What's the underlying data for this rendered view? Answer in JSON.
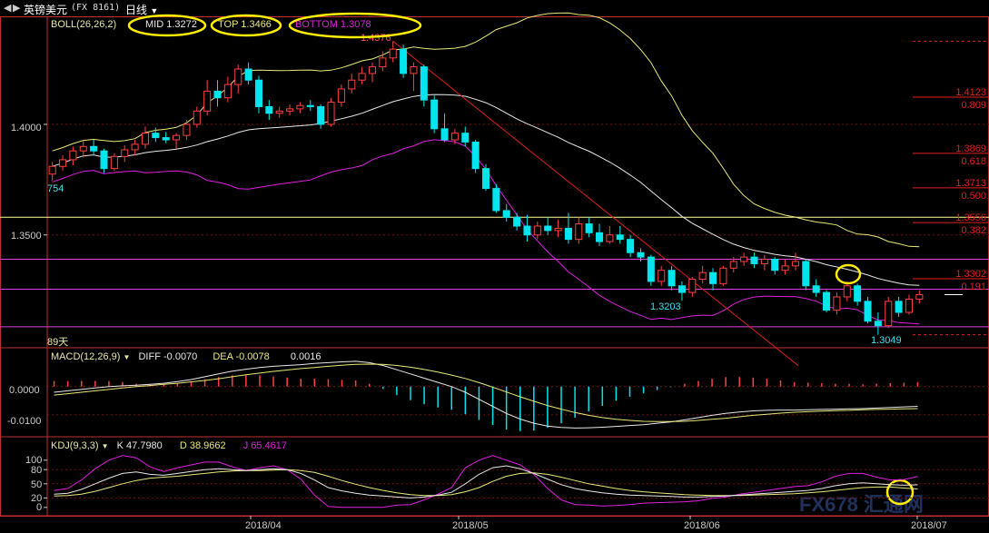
{
  "window": {
    "title": "英镑美元",
    "symbol_code": "(FX 8161)",
    "timeframe": "日线",
    "nav_icons": [
      "chevron-left-icon",
      "chevron-right-icon"
    ]
  },
  "colors": {
    "up": "#ff4040",
    "down": "#00e5ee",
    "mid": "#e8e8e8",
    "top": "#e8e878",
    "bottom": "#e020e0",
    "trend": "#e02020",
    "fib": "#e02020",
    "hline_yellow": "#ffff99",
    "hline_magenta": "#e040e0",
    "highlight": "#ffee00",
    "axis": "#cccccc",
    "panel_border": "#c03030"
  },
  "chart_data": [
    {
      "type": "candlestick",
      "title": "",
      "indicator_label": "BOLL(26,26,2)",
      "legend": [
        {
          "name": "MID",
          "value": "1.3272"
        },
        {
          "name": "TOP",
          "value": "1.3466"
        },
        {
          "name": "BOTTOM",
          "value": "1.3078"
        }
      ],
      "y_ticks": [
        "1.4000",
        "1.3500"
      ],
      "x_ticks": [
        "2018/04",
        "2018/05",
        "2018/06",
        "2018/07"
      ],
      "annotations": {
        "high": "1.4376",
        "low1": "1.3203",
        "low2": "1.3049",
        "left_edge": "754",
        "period": "89天"
      },
      "fib_levels": [
        {
          "price": "1.4123",
          "ratio": "0.809"
        },
        {
          "price": "1.3869",
          "ratio": "0.618"
        },
        {
          "price": "1.3713",
          "ratio": "0.500"
        },
        {
          "price": "1.3556",
          "ratio": "0.382"
        },
        {
          "price": "1.3302",
          "ratio": "0.191"
        }
      ],
      "horizontal_lines": [
        1.358,
        1.339,
        1.3255,
        1.3085
      ],
      "trend_line": {
        "from": {
          "i": 33,
          "p": 1.4376
        },
        "to": {
          "i": 67,
          "p": 1.295
        }
      },
      "ohlc": [
        [
          1.3775,
          1.383,
          1.3745,
          1.381
        ],
        [
          1.381,
          1.386,
          1.379,
          1.384
        ],
        [
          1.384,
          1.39,
          1.3815,
          1.388
        ],
        [
          1.388,
          1.3925,
          1.385,
          1.39
        ],
        [
          1.39,
          1.393,
          1.386,
          1.388
        ],
        [
          1.388,
          1.389,
          1.378,
          1.38
        ],
        [
          1.38,
          1.387,
          1.379,
          1.3855
        ],
        [
          1.3855,
          1.3905,
          1.383,
          1.3885
        ],
        [
          1.3885,
          1.393,
          1.386,
          1.391
        ],
        [
          1.391,
          1.399,
          1.389,
          1.396
        ],
        [
          1.396,
          1.3985,
          1.392,
          1.394
        ],
        [
          1.394,
          1.3965,
          1.3915,
          1.393
        ],
        [
          1.393,
          1.396,
          1.389,
          1.395
        ],
        [
          1.395,
          1.402,
          1.393,
          1.4
        ],
        [
          1.4,
          1.408,
          1.3985,
          1.406
        ],
        [
          1.406,
          1.42,
          1.404,
          1.415
        ],
        [
          1.415,
          1.42,
          1.408,
          1.412
        ],
        [
          1.412,
          1.4215,
          1.41,
          1.418
        ],
        [
          1.418,
          1.427,
          1.414,
          1.425
        ],
        [
          1.425,
          1.428,
          1.418,
          1.42
        ],
        [
          1.42,
          1.422,
          1.405,
          1.408
        ],
        [
          1.408,
          1.411,
          1.402,
          1.405
        ],
        [
          1.405,
          1.408,
          1.403,
          1.406
        ],
        [
          1.406,
          1.409,
          1.404,
          1.407
        ],
        [
          1.407,
          1.41,
          1.405,
          1.4085
        ],
        [
          1.4085,
          1.411,
          1.406,
          1.408
        ],
        [
          1.408,
          1.409,
          1.398,
          1.4
        ],
        [
          1.4,
          1.412,
          1.399,
          1.41
        ],
        [
          1.41,
          1.418,
          1.408,
          1.416
        ],
        [
          1.416,
          1.423,
          1.414,
          1.42
        ],
        [
          1.42,
          1.426,
          1.418,
          1.423
        ],
        [
          1.423,
          1.428,
          1.419,
          1.426
        ],
        [
          1.426,
          1.433,
          1.424,
          1.43
        ],
        [
          1.43,
          1.4376,
          1.428,
          1.434
        ],
        [
          1.434,
          1.436,
          1.421,
          1.423
        ],
        [
          1.423,
          1.428,
          1.415,
          1.426
        ],
        [
          1.426,
          1.427,
          1.408,
          1.411
        ],
        [
          1.411,
          1.413,
          1.396,
          1.398
        ],
        [
          1.398,
          1.405,
          1.392,
          1.393
        ],
        [
          1.393,
          1.398,
          1.391,
          1.396
        ],
        [
          1.396,
          1.399,
          1.39,
          1.392
        ],
        [
          1.392,
          1.393,
          1.378,
          1.38
        ],
        [
          1.38,
          1.382,
          1.37,
          1.371
        ],
        [
          1.371,
          1.373,
          1.36,
          1.361
        ],
        [
          1.361,
          1.364,
          1.356,
          1.358
        ],
        [
          1.358,
          1.36,
          1.352,
          1.354
        ],
        [
          1.354,
          1.359,
          1.347,
          1.35
        ],
        [
          1.35,
          1.356,
          1.348,
          1.354
        ],
        [
          1.354,
          1.358,
          1.35,
          1.352
        ],
        [
          1.352,
          1.357,
          1.349,
          1.353
        ],
        [
          1.353,
          1.36,
          1.346,
          1.348
        ],
        [
          1.348,
          1.358,
          1.346,
          1.355
        ],
        [
          1.355,
          1.358,
          1.349,
          1.351
        ],
        [
          1.351,
          1.355,
          1.345,
          1.347
        ],
        [
          1.347,
          1.354,
          1.346,
          1.35
        ],
        [
          1.35,
          1.354,
          1.346,
          1.348
        ],
        [
          1.348,
          1.35,
          1.34,
          1.342
        ],
        [
          1.342,
          1.344,
          1.338,
          1.34
        ],
        [
          1.34,
          1.341,
          1.327,
          1.329
        ],
        [
          1.329,
          1.336,
          1.327,
          1.334
        ],
        [
          1.334,
          1.336,
          1.325,
          1.327
        ],
        [
          1.327,
          1.329,
          1.3203,
          1.324
        ],
        [
          1.324,
          1.331,
          1.322,
          1.33
        ],
        [
          1.33,
          1.336,
          1.328,
          1.333
        ],
        [
          1.333,
          1.335,
          1.325,
          1.328
        ],
        [
          1.328,
          1.336,
          1.327,
          1.335
        ],
        [
          1.335,
          1.34,
          1.333,
          1.338
        ],
        [
          1.338,
          1.342,
          1.336,
          1.34
        ],
        [
          1.34,
          1.342,
          1.335,
          1.337
        ],
        [
          1.337,
          1.341,
          1.334,
          1.339
        ],
        [
          1.339,
          1.34,
          1.332,
          1.334
        ],
        [
          1.334,
          1.339,
          1.332,
          1.336
        ],
        [
          1.336,
          1.342,
          1.334,
          1.338
        ],
        [
          1.338,
          1.339,
          1.325,
          1.327
        ],
        [
          1.327,
          1.33,
          1.322,
          1.324
        ],
        [
          1.324,
          1.325,
          1.315,
          1.316
        ],
        [
          1.316,
          1.324,
          1.314,
          1.322
        ],
        [
          1.322,
          1.329,
          1.32,
          1.327
        ],
        [
          1.327,
          1.328,
          1.318,
          1.32
        ],
        [
          1.32,
          1.322,
          1.31,
          1.311
        ],
        [
          1.311,
          1.315,
          1.3049,
          1.309
        ],
        [
          1.309,
          1.322,
          1.308,
          1.32
        ],
        [
          1.32,
          1.322,
          1.313,
          1.315
        ],
        [
          1.315,
          1.323,
          1.314,
          1.321
        ],
        [
          1.321,
          1.325,
          1.319,
          1.323
        ]
      ]
    },
    {
      "type": "macd",
      "indicator_label": "MACD(12,26,9)",
      "legend": [
        {
          "name": "DIFF",
          "value": "-0.0070"
        },
        {
          "name": "DEA",
          "value": "-0.0078"
        },
        {
          "name": "",
          "value": "0.0016"
        }
      ],
      "y_ticks": [
        "0.0000",
        "-0.0100"
      ],
      "diff": [
        -0.002,
        -0.0015,
        -0.001,
        -0.0005,
        0,
        0.0003,
        0.0005,
        0.0008,
        0.0012,
        0.0018,
        0.0025,
        0.0035,
        0.0045,
        0.0055,
        0.0062,
        0.0068,
        0.0072,
        0.0075,
        0.0078,
        0.0082,
        0.0085,
        0.0088,
        0.009,
        0.0085,
        0.0075,
        0.006,
        0.0045,
        0.003,
        0.0015,
        0,
        -0.002,
        -0.0045,
        -0.007,
        -0.0095,
        -0.0115,
        -0.013,
        -0.014,
        -0.0145,
        -0.0147,
        -0.0146,
        -0.0144,
        -0.0141,
        -0.0138,
        -0.0135,
        -0.013,
        -0.0125,
        -0.0118,
        -0.011,
        -0.0102,
        -0.0095,
        -0.009,
        -0.0086,
        -0.0084,
        -0.0083,
        -0.0083,
        -0.0082,
        -0.0081,
        -0.008,
        -0.0079,
        -0.0078,
        -0.0076,
        -0.0074,
        -0.0072,
        -0.007
      ],
      "dea": [
        -0.003,
        -0.0025,
        -0.002,
        -0.0015,
        -0.001,
        -0.0005,
        0,
        0.0004,
        0.0008,
        0.0012,
        0.0017,
        0.0022,
        0.0028,
        0.0035,
        0.0042,
        0.0048,
        0.0054,
        0.0059,
        0.0064,
        0.0068,
        0.0072,
        0.0076,
        0.0079,
        0.008,
        0.0079,
        0.0075,
        0.0069,
        0.0061,
        0.0052,
        0.0041,
        0.0029,
        0.0014,
        -0.0002,
        -0.0019,
        -0.0036,
        -0.0052,
        -0.0067,
        -0.008,
        -0.0092,
        -0.0102,
        -0.011,
        -0.0116,
        -0.012,
        -0.0123,
        -0.0124,
        -0.0124,
        -0.0123,
        -0.012,
        -0.0116,
        -0.0112,
        -0.0107,
        -0.0102,
        -0.0098,
        -0.0094,
        -0.0091,
        -0.0089,
        -0.0087,
        -0.0085,
        -0.0084,
        -0.0082,
        -0.0081,
        -0.008,
        -0.0079,
        -0.0078
      ]
    },
    {
      "type": "kdj",
      "indicator_label": "KDJ(9,3,3)",
      "legend": [
        {
          "name": "K",
          "value": "47.7980"
        },
        {
          "name": "D",
          "value": "38.9662"
        },
        {
          "name": "J",
          "value": "65.4617"
        }
      ],
      "y_ticks": [
        "100",
        "80",
        "50",
        "20",
        "0"
      ],
      "k": [
        28,
        30,
        38,
        50,
        62,
        72,
        75,
        70,
        68,
        72,
        76,
        80,
        82,
        80,
        78,
        80,
        82,
        80,
        72,
        58,
        42,
        35,
        30,
        26,
        24,
        22,
        20,
        22,
        26,
        32,
        50,
        70,
        84,
        88,
        82,
        72,
        60,
        48,
        40,
        35,
        31,
        28,
        26,
        25,
        24,
        23,
        22,
        22,
        23,
        24,
        26,
        28,
        30,
        32,
        34,
        36,
        40,
        46,
        50,
        52,
        50,
        48,
        47,
        47.8
      ],
      "d": [
        24,
        25,
        28,
        34,
        42,
        50,
        57,
        62,
        64,
        66,
        69,
        72,
        75,
        77,
        78,
        78,
        79,
        80,
        78,
        74,
        66,
        57,
        49,
        42,
        36,
        31,
        27,
        25,
        25,
        27,
        33,
        42,
        55,
        66,
        72,
        73,
        70,
        64,
        57,
        50,
        45,
        40,
        36,
        33,
        31,
        29,
        27,
        26,
        25,
        25,
        25,
        26,
        27,
        28,
        29,
        31,
        33,
        36,
        39,
        42,
        43,
        43,
        41,
        38.97
      ],
      "j": [
        36,
        40,
        58,
        82,
        100,
        110,
        105,
        86,
        76,
        84,
        90,
        96,
        96,
        86,
        78,
        84,
        88,
        80,
        60,
        26,
        2,
        0,
        0,
        0,
        0,
        5,
        6,
        16,
        28,
        42,
        84,
        100,
        110,
        100,
        90,
        70,
        40,
        16,
        6,
        5,
        3,
        4,
        6,
        9,
        10,
        11,
        12,
        14,
        19,
        22,
        28,
        32,
        36,
        40,
        44,
        46,
        54,
        66,
        72,
        72,
        64,
        58,
        59,
        65.46
      ]
    }
  ],
  "watermark": "FX678 汇通网"
}
